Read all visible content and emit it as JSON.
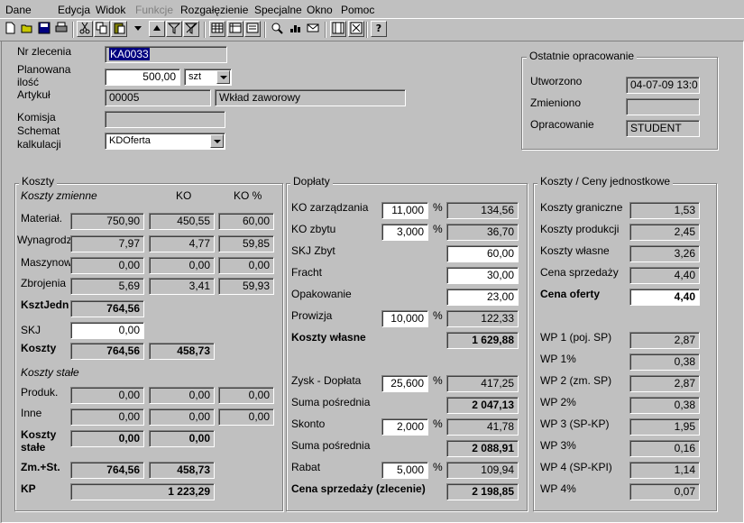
{
  "menu": {
    "items": [
      {
        "label": "Dane",
        "disabled": false
      },
      {
        "label": "Edycja",
        "disabled": false
      },
      {
        "label": "Widok",
        "disabled": false
      },
      {
        "label": "Funkcje",
        "disabled": true
      },
      {
        "label": "Rozgałęzienie",
        "disabled": false
      },
      {
        "label": "Specjalne",
        "disabled": false
      },
      {
        "label": "Okno",
        "disabled": false
      },
      {
        "label": "Pomoc",
        "disabled": false
      }
    ]
  },
  "toolbar": {
    "icons": [
      "new-document-icon",
      "open-folder-icon",
      "save-icon",
      "print-icon",
      "cut-icon",
      "copy-icon",
      "paste-icon",
      "dropdown-arrow-icon",
      "sort-up-icon",
      "filter-icon",
      "clear-filter-icon",
      "grid-view-icon",
      "table-view-icon",
      "form-view-icon",
      "zoom-icon",
      "chart-icon",
      "mail-icon",
      "layout-icon",
      "delete-icon",
      "help-icon"
    ],
    "help_glyph": "?"
  },
  "header": {
    "order_no_label": "Nr zlecenia",
    "order_no": "KA0033",
    "planned_qty_label_1": "Planowana",
    "planned_qty_label_2": "ilość",
    "planned_qty": "500,00",
    "unit": "szt",
    "article_label": "Artykuł",
    "article_no": "00005",
    "article_name": "Wkład  zaworowy",
    "commission_label": "Komisja",
    "commission": "",
    "scheme_label_1": "Schemat",
    "scheme_label_2": "kalkulacji",
    "scheme": "KDOferta"
  },
  "last_edit": {
    "title": "Ostatnie opracowanie",
    "created_label": "Utworzono",
    "created": "04-07-09 13:0",
    "changed_label": "Zmieniono",
    "changed": "",
    "edited_label": "Opracowanie",
    "edited": "STUDENT"
  },
  "costs": {
    "title": "Koszty",
    "variable_title": "Koszty zmienne",
    "ko_header": "KO",
    "ko_pct_header": "KO  %",
    "rows": [
      {
        "label": "Materiał.",
        "value": "750,90",
        "ko": "450,55",
        "pct": "60,00"
      },
      {
        "label": "Wynagrodz.",
        "value": "7,97",
        "ko": "4,77",
        "pct": "59,85"
      },
      {
        "label": "Maszynowe",
        "value": "0,00",
        "ko": "0,00",
        "pct": "0,00"
      },
      {
        "label": "Zbrojenia",
        "value": "5,69",
        "ko": "3,41",
        "pct": "59,93"
      }
    ],
    "unit_label": "KsztJedn",
    "unit_value": "764,56",
    "skj_label": "SKJ",
    "skj_value": "0,00",
    "total_label": "Koszty",
    "total_value": "764,56",
    "total_ko": "458,73",
    "fixed_title": "Koszty stałe",
    "fixed_rows": [
      {
        "label": "Produk.",
        "value": "0,00",
        "ko": "0,00",
        "pct": "0,00"
      },
      {
        "label": "Inne",
        "value": "0,00",
        "ko": "0,00",
        "pct": "0,00"
      }
    ],
    "fixed_total_label_1": "Koszty",
    "fixed_total_label_2": "stałe",
    "fixed_total_value": "0,00",
    "fixed_total_ko": "0,00",
    "zmst_label": "Zm.+St.",
    "zmst_value": "764,56",
    "zmst_ko": "458,73",
    "kp_label": "KP",
    "kp_value": "1 223,29"
  },
  "surcharges": {
    "title": "Dopłaty",
    "pct_sign": "%",
    "ko_mgmt_label": "KO zarządzania",
    "ko_mgmt_pct": "11,000",
    "ko_mgmt_value": "134,56",
    "ko_sales_label": "KO zbytu",
    "ko_sales_pct": "3,000",
    "ko_sales_value": "36,70",
    "skj_sales_label": "SKJ Zbyt",
    "skj_sales_value": "60,00",
    "freight_label": "Fracht",
    "freight_value": "30,00",
    "packaging_label": "Opakowanie",
    "packaging_value": "23,00",
    "commission_label": "Prowizja",
    "commission_pct": "10,000",
    "commission_value": "122,33",
    "own_costs_label": "Koszty własne",
    "own_costs_value": "1 629,88",
    "profit_label": "Zysk - Dopłata",
    "profit_pct": "25,600",
    "profit_value": "417,25",
    "subtotal1_label": "Suma pośrednia",
    "subtotal1_value": "2 047,13",
    "discount_label": "Skonto",
    "discount_pct": "2,000",
    "discount_value": "41,78",
    "subtotal2_label": "Suma pośrednia",
    "subtotal2_value": "2 088,91",
    "rebate_label": "Rabat",
    "rebate_pct": "5,000",
    "rebate_value": "109,94",
    "sale_price_label": "Cena sprzedaży (zlecenie)",
    "sale_price_value": "2 198,85"
  },
  "unit_prices": {
    "title": "Koszty / Ceny jednostkowe",
    "rows": [
      {
        "label": "Koszty graniczne",
        "value": "1,53"
      },
      {
        "label": "Koszty produkcji",
        "value": "2,45"
      },
      {
        "label": "Koszty własne",
        "value": "3,26"
      },
      {
        "label": "Cena sprzedaży",
        "value": "4,40"
      }
    ],
    "offer_label": "Cena oferty",
    "offer_value": "4,40",
    "wp_rows": [
      {
        "label": "WP 1 (poj. SP)",
        "value": "2,87"
      },
      {
        "label": "WP 1%",
        "value": "0,38"
      },
      {
        "label": "WP 2 (zm. SP)",
        "value": "2,87"
      },
      {
        "label": "WP 2%",
        "value": "0,38"
      },
      {
        "label": "WP 3 (SP-KP)",
        "value": "1,95"
      },
      {
        "label": "WP 3%",
        "value": "0,16"
      },
      {
        "label": "WP 4 (SP-KPI)",
        "value": "1,14"
      },
      {
        "label": "WP 4%",
        "value": "0,07"
      }
    ]
  }
}
